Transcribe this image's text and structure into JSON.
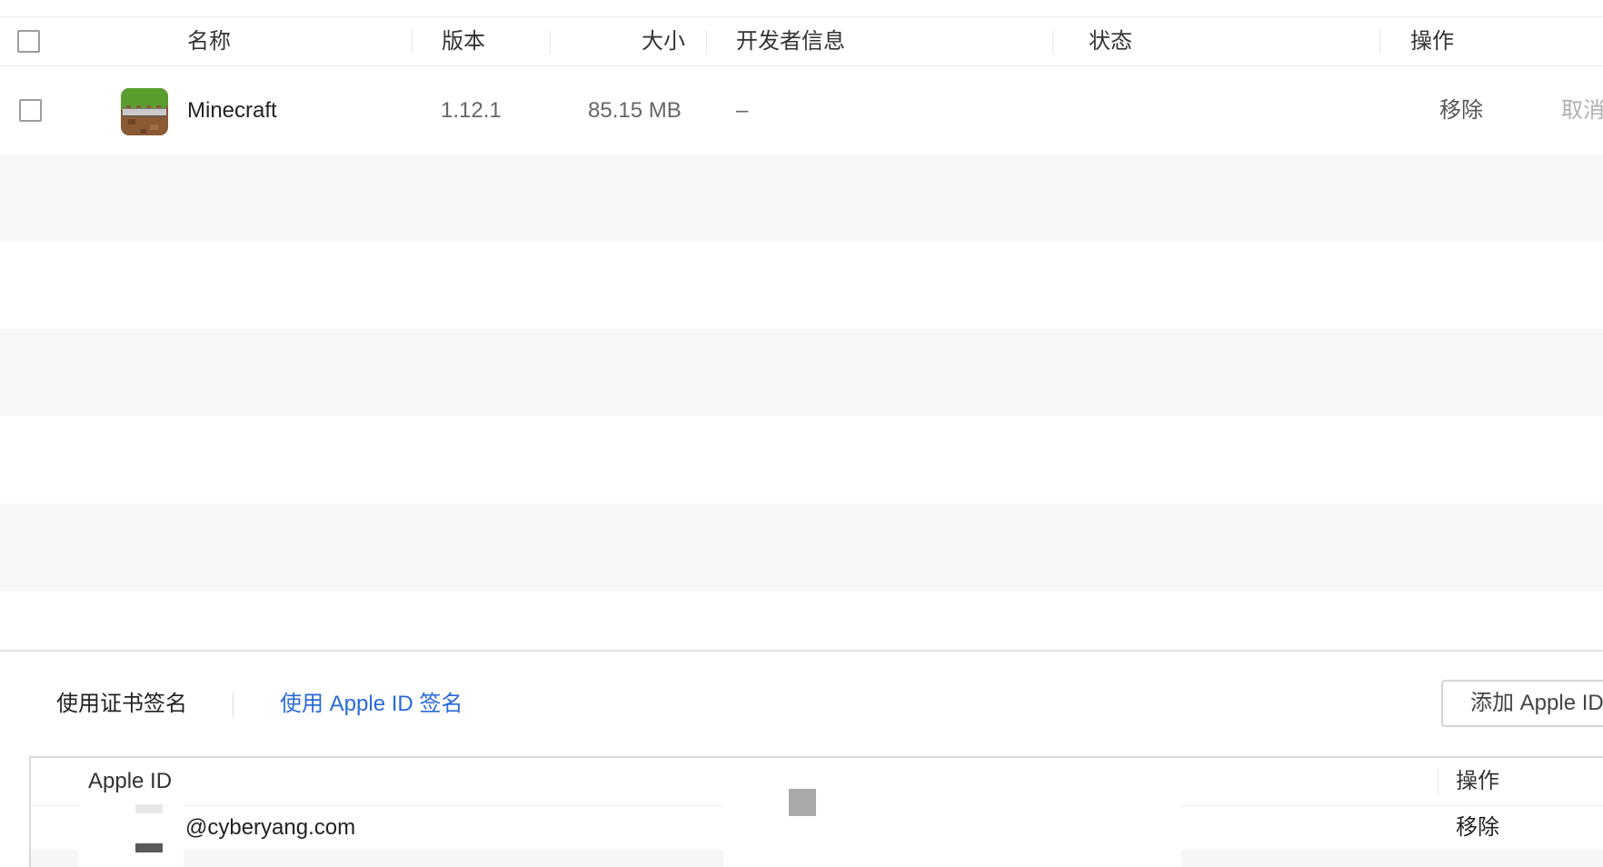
{
  "app_table": {
    "headers": {
      "name": "名称",
      "version": "版本",
      "size": "大小",
      "developer": "开发者信息",
      "status": "状态",
      "actions": "操作"
    },
    "rows": [
      {
        "icon": "minecraft-app-icon",
        "name": "Minecraft",
        "version": "1.12.1",
        "size": "85.15 MB",
        "developer": "–",
        "status": "",
        "remove_label": "移除",
        "cancel_label": "取消"
      }
    ]
  },
  "sign_tabs": {
    "certificate_label": "使用证书签名",
    "apple_id_label": "使用 Apple ID 签名"
  },
  "add_apple_id_label": "添加 Apple ID",
  "apple_id_table": {
    "headers": {
      "apple_id": "Apple ID",
      "actions": "操作"
    },
    "rows": [
      {
        "apple_id": "@cyberyang.com",
        "remove_label": "移除"
      }
    ]
  },
  "colors": {
    "link_blue": "#2a6ad8",
    "zebra_gray": "#f8f8f8",
    "border": "#e0e0e0"
  }
}
